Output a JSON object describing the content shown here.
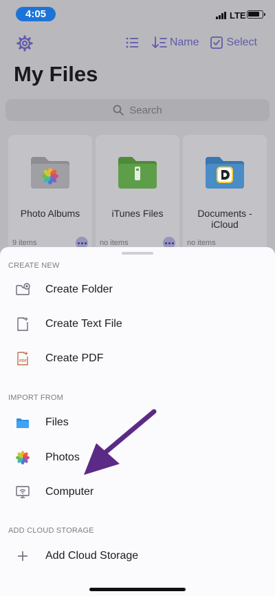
{
  "status_bar": {
    "time": "4:05",
    "network": "LTE"
  },
  "toolbar": {
    "sort_label": "Name",
    "select_label": "Select"
  },
  "page_title": "My Files",
  "search": {
    "placeholder": "Search"
  },
  "cards": [
    {
      "label": "Photo Albums",
      "count": "9 items",
      "icon": "photos-folder-icon"
    },
    {
      "label": "iTunes Files",
      "count": "no items",
      "icon": "itunes-folder-icon"
    },
    {
      "label_line1": "Documents -",
      "label_line2": "iCloud",
      "count": "no items",
      "icon": "documents-folder-icon"
    }
  ],
  "sheet": {
    "create_header": "CREATE NEW",
    "create_items": [
      "Create Folder",
      "Create Text File",
      "Create PDF"
    ],
    "import_header": "IMPORT FROM",
    "import_items": [
      "Files",
      "Photos",
      "Computer"
    ],
    "cloud_header": "ADD CLOUD STORAGE",
    "cloud_items": [
      "Add Cloud Storage"
    ]
  },
  "colors": {
    "accent": "#5f5aa8",
    "arrow": "#5b2a86",
    "time_pill": "#1d74d8"
  }
}
